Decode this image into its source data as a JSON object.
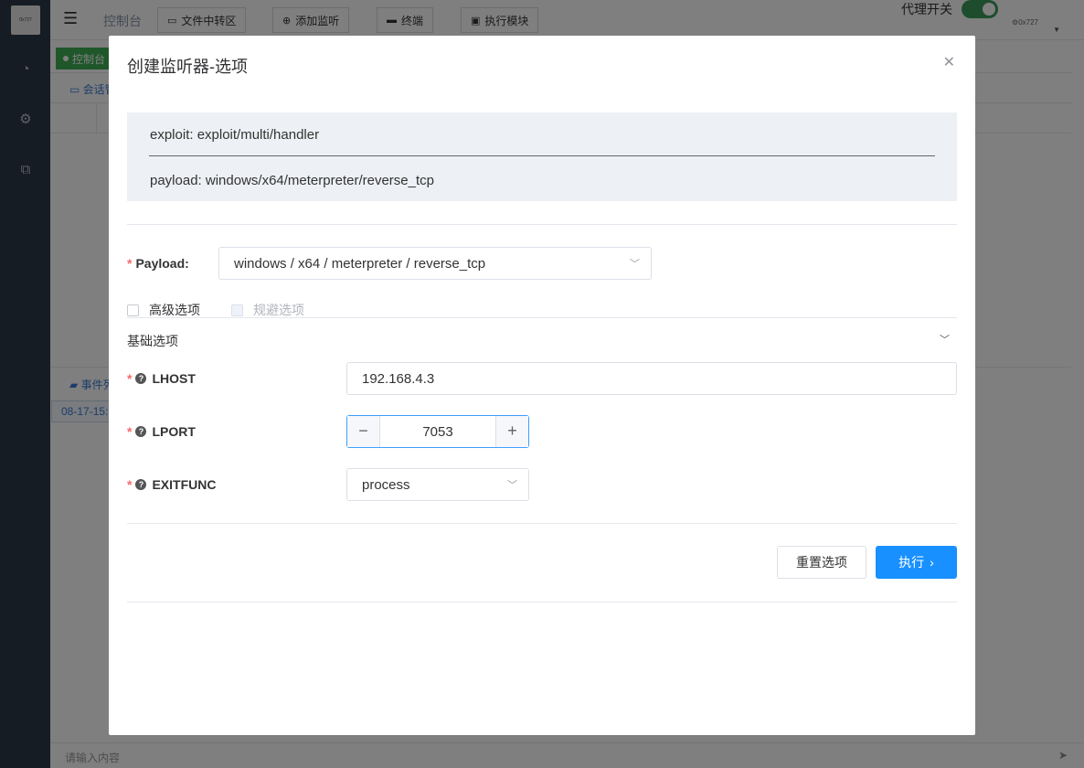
{
  "app": {
    "logo_text": "0x727",
    "breadcrumb": "控制台",
    "toolbar": [
      {
        "label": "文件中转区",
        "icon": "folder-icon"
      },
      {
        "label": "添加监听",
        "icon": "plus-circle-icon"
      },
      {
        "label": "终端",
        "icon": "monitor-icon"
      },
      {
        "label": "执行模块",
        "icon": "module-icon"
      }
    ],
    "proxy_label": "代理开关",
    "proxy_on": true,
    "user_name": "0x727",
    "tab_label": "控制台",
    "session_label": "会话管",
    "event_label": "事件列",
    "event_time": "08-17-15:",
    "input_placeholder": "请输入内容"
  },
  "modal": {
    "title": "创建监听器-选项",
    "exploit_line": "exploit: exploit/multi/handler",
    "payload_line": "payload: windows/x64/meterpreter/reverse_tcp",
    "payload_label": "Payload:",
    "payload_value": "windows / x64 / meterpreter / reverse_tcp",
    "checkbox_advanced": "高级选项",
    "checkbox_evasion": "规避选项",
    "section_basic": "基础选项",
    "lhost_label": "LHOST",
    "lhost_value": "192.168.4.3",
    "lport_label": "LPORT",
    "lport_value": "7053",
    "exitfunc_label": "EXITFUNC",
    "exitfunc_value": "process",
    "reset_button": "重置选项",
    "execute_button": "执行"
  },
  "colors": {
    "primary": "#1890ff",
    "required": "#f56c6c",
    "switch_on": "#3a9a5a",
    "sidebar": "#2d3848"
  }
}
